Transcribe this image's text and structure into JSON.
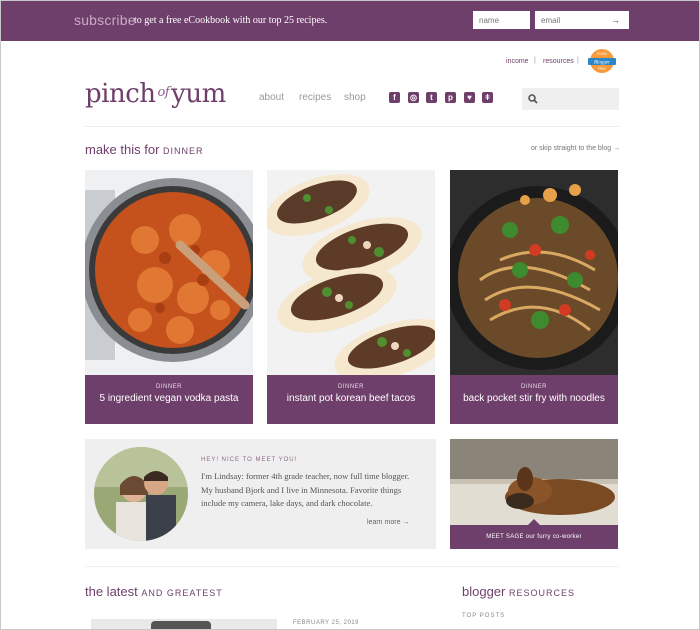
{
  "topbar": {
    "subscribe_label": "subscribe",
    "promo_text": "to get a free eCookbook with our top 25 recipes.",
    "name_placeholder": "name",
    "email_placeholder": "email",
    "submit_icon": "arrow-right-icon"
  },
  "header": {
    "links": [
      "income",
      "resources"
    ],
    "logo": {
      "part1": "pinch",
      "part2": "of",
      "part3": "yum"
    },
    "badge": {
      "line1": "FOOD",
      "line2": "Blogger",
      "line3": "PRO"
    },
    "nav": [
      "about",
      "recipes",
      "shop"
    ],
    "social_icons": [
      "facebook-icon",
      "instagram-icon",
      "twitter-icon",
      "pinterest-icon",
      "heart-icon",
      "rss-icon"
    ],
    "search_placeholder": ""
  },
  "dinner_section": {
    "heading": "make this for",
    "heading_caps": "DINNER",
    "skip_link": "or skip straight to the blog"
  },
  "recipes": [
    {
      "category": "DINNER",
      "title": "5 ingredient vegan vodka pasta"
    },
    {
      "category": "DINNER",
      "title": "instant pot korean beef tacos"
    },
    {
      "category": "DINNER",
      "title": "back pocket stir fry with noodles"
    }
  ],
  "about": {
    "kicker": "HEY! NICE TO MEET YOU!",
    "bio": "I'm Lindsay: former 4th grade teacher, now full time blogger. My husband Bjork and I live in Minnesota. Favorite things include my camera, lake days, and dark chocolate.",
    "learn_more": "learn more"
  },
  "sage": {
    "caption": "MEET SAGE our furry co-worker"
  },
  "latest": {
    "heading": "the latest",
    "heading_caps": "AND GREATEST",
    "date": "FEBRUARY 25, 2019"
  },
  "sidebar": {
    "heading": "blogger",
    "heading_caps": "RESOURCES",
    "top_posts": "TOP POSTS"
  },
  "colors": {
    "brand": "#6f3f6b",
    "subscribe": "#c9abc5",
    "panel": "#efefef"
  }
}
